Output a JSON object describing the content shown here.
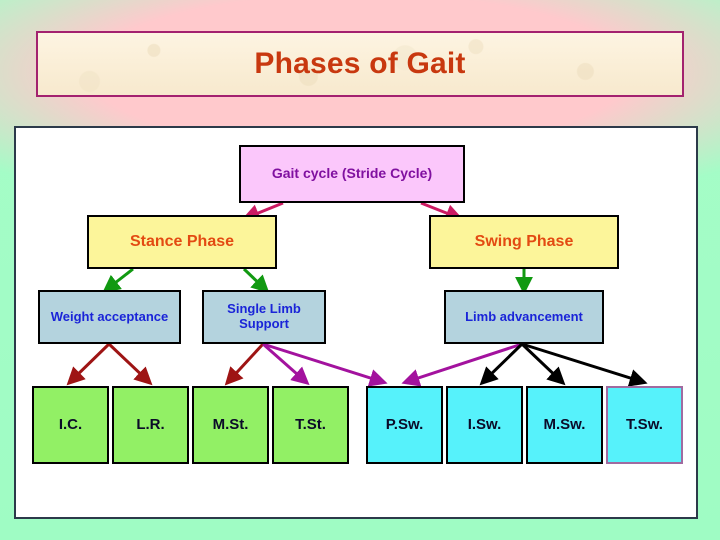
{
  "slide": {
    "title": "Phases of Gait",
    "background_color": "#9ffcc4",
    "banner_band_color": "#ffc9cc",
    "title_color": "#c8380f",
    "banner_border_color": "#a3216f",
    "panel_border_color": "#2c3a4a",
    "panel_background": "#ffffff"
  },
  "diagram": {
    "type": "hierarchy-flowchart",
    "nodes": {
      "root": {
        "label": "Gait cycle (Stride Cycle)",
        "fill": "#fbc7fb",
        "text_color": "#8010a0"
      },
      "stance_phase": {
        "label": "Stance Phase",
        "fill": "#fcf59a",
        "text_color": "#e34a12"
      },
      "swing_phase": {
        "label": "Swing Phase",
        "fill": "#fcf59a",
        "text_color": "#e34a12"
      },
      "weight_acceptance": {
        "label": "Weight acceptance",
        "fill": "#b4d3de",
        "text_color": "#1a24d8"
      },
      "single_limb_support": {
        "label": "Single Limb Support",
        "fill": "#b4d3de",
        "text_color": "#1a24d8"
      },
      "limb_advancement": {
        "label": "Limb advancement",
        "fill": "#b4d3de",
        "text_color": "#1a24d8"
      },
      "ic": {
        "label": "I.C.",
        "fill": "#92f065",
        "text_color": "#0b0b28"
      },
      "lr": {
        "label": "L.R.",
        "fill": "#92f065",
        "text_color": "#0b0b28"
      },
      "mst": {
        "label": "M.St.",
        "fill": "#92f065",
        "text_color": "#0b0b28"
      },
      "tst": {
        "label": "T.St.",
        "fill": "#92f065",
        "text_color": "#0b0b28"
      },
      "psw": {
        "label": "P.Sw.",
        "fill": "#56f2fb",
        "text_color": "#0b0b28"
      },
      "isw": {
        "label": "I.Sw.",
        "fill": "#56f2fb",
        "text_color": "#0b0b28"
      },
      "msw": {
        "label": "M.Sw.",
        "fill": "#56f2fb",
        "text_color": "#0b0b28"
      },
      "tsw": {
        "label": "T.Sw.",
        "fill": "#56f2fb",
        "text_color": "#0b0b28",
        "border_color": "#a06ba0"
      }
    },
    "edges": [
      {
        "from": "root",
        "to": "stance_phase",
        "color": "#cc1a63"
      },
      {
        "from": "root",
        "to": "swing_phase",
        "color": "#cc1a63"
      },
      {
        "from": "stance_phase",
        "to": "weight_acceptance",
        "color": "#119911"
      },
      {
        "from": "stance_phase",
        "to": "single_limb_support",
        "color": "#119911"
      },
      {
        "from": "swing_phase",
        "to": "limb_advancement",
        "color": "#119911"
      },
      {
        "from": "weight_acceptance",
        "to": "ic",
        "color": "#9e1414"
      },
      {
        "from": "weight_acceptance",
        "to": "lr",
        "color": "#9e1414"
      },
      {
        "from": "single_limb_support",
        "to": "mst",
        "color": "#9e1414"
      },
      {
        "from": "single_limb_support",
        "to": "tst",
        "color": "#a3129e"
      },
      {
        "from": "single_limb_support",
        "to": "psw",
        "color": "#a3129e"
      },
      {
        "from": "limb_advancement",
        "to": "psw",
        "color": "#a3129e"
      },
      {
        "from": "limb_advancement",
        "to": "isw",
        "color": "#000000"
      },
      {
        "from": "limb_advancement",
        "to": "msw",
        "color": "#000000"
      },
      {
        "from": "limb_advancement",
        "to": "tsw",
        "color": "#000000"
      }
    ]
  }
}
